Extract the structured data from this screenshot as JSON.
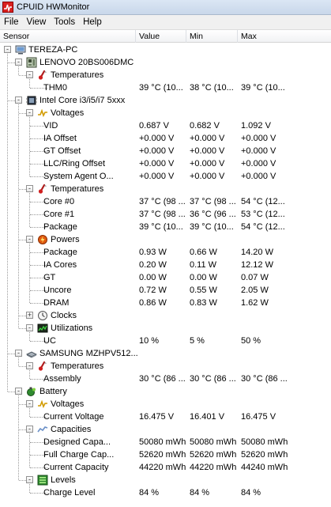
{
  "window": {
    "title": "CPUID HWMonitor"
  },
  "menu": [
    "File",
    "View",
    "Tools",
    "Help"
  ],
  "columns": {
    "sensor": "Sensor",
    "value": "Value",
    "min": "Min",
    "max": "Max"
  },
  "tree": [
    {
      "label": "TEREZA-PC",
      "icon": "computer-icon",
      "expander": "-"
    },
    {
      "label": "LENOVO 20BS006DMC",
      "icon": "motherboard-icon",
      "expander": "-"
    },
    {
      "label": "Temperatures",
      "icon": "thermometer-icon",
      "expander": "-"
    },
    {
      "label": "THM0",
      "value": "39 °C  (10...",
      "min": "38 °C  (10...",
      "max": "39 °C  (10..."
    },
    {
      "label": "Intel Core i3/i5/i7 5xxx",
      "icon": "cpu-chip-icon",
      "expander": "-"
    },
    {
      "label": "Voltages",
      "icon": "voltage-icon",
      "expander": "-"
    },
    {
      "label": "VID",
      "value": "0.687 V",
      "min": "0.682 V",
      "max": "1.092 V"
    },
    {
      "label": "IA Offset",
      "value": "+0.000 V",
      "min": "+0.000 V",
      "max": "+0.000 V"
    },
    {
      "label": "GT Offset",
      "value": "+0.000 V",
      "min": "+0.000 V",
      "max": "+0.000 V"
    },
    {
      "label": "LLC/Ring Offset",
      "value": "+0.000 V",
      "min": "+0.000 V",
      "max": "+0.000 V"
    },
    {
      "label": "System Agent O...",
      "value": "+0.000 V",
      "min": "+0.000 V",
      "max": "+0.000 V"
    },
    {
      "label": "Temperatures",
      "icon": "thermometer-icon",
      "expander": "-"
    },
    {
      "label": "Core #0",
      "value": "37 °C  (98 ...",
      "min": "37 °C  (98 ...",
      "max": "54 °C  (12..."
    },
    {
      "label": "Core #1",
      "value": "37 °C  (98 ...",
      "min": "36 °C  (96 ...",
      "max": "53 °C  (12..."
    },
    {
      "label": "Package",
      "value": "39 °C  (10...",
      "min": "39 °C  (10...",
      "max": "54 °C  (12..."
    },
    {
      "label": "Powers",
      "icon": "power-icon",
      "expander": "-"
    },
    {
      "label": "Package",
      "value": "0.93 W",
      "min": "0.66 W",
      "max": "14.20 W"
    },
    {
      "label": "IA Cores",
      "value": "0.20 W",
      "min": "0.11 W",
      "max": "12.12 W"
    },
    {
      "label": "GT",
      "value": "0.00 W",
      "min": "0.00 W",
      "max": "0.07 W"
    },
    {
      "label": "Uncore",
      "value": "0.72 W",
      "min": "0.55 W",
      "max": "2.05 W"
    },
    {
      "label": "DRAM",
      "value": "0.86 W",
      "min": "0.83 W",
      "max": "1.62 W"
    },
    {
      "label": "Clocks",
      "icon": "clock-icon",
      "expander": "+"
    },
    {
      "label": "Utilizations",
      "icon": "utilization-icon",
      "expander": "-"
    },
    {
      "label": "UC",
      "value": "10 %",
      "min": "5 %",
      "max": "50 %"
    },
    {
      "label": "SAMSUNG MZHPV512...",
      "icon": "drive-icon",
      "expander": "-"
    },
    {
      "label": "Temperatures",
      "icon": "thermometer-icon",
      "expander": "-"
    },
    {
      "label": "Assembly",
      "value": "30 °C  (86 ...",
      "min": "30 °C  (86 ...",
      "max": "30 °C  (86 ..."
    },
    {
      "label": "Battery",
      "icon": "battery-icon",
      "expander": "-"
    },
    {
      "label": "Voltages",
      "icon": "voltage-icon",
      "expander": "-"
    },
    {
      "label": "Current Voltage",
      "value": "16.475 V",
      "min": "16.401 V",
      "max": "16.475 V"
    },
    {
      "label": "Capacities",
      "icon": "capacity-icon",
      "expander": "-"
    },
    {
      "label": "Designed Capa...",
      "value": "50080 mWh",
      "min": "50080 mWh",
      "max": "50080 mWh"
    },
    {
      "label": "Full Charge Cap...",
      "value": "52620 mWh",
      "min": "52620 mWh",
      "max": "52620 mWh"
    },
    {
      "label": "Current Capacity",
      "value": "44220 mWh",
      "min": "44220 mWh",
      "max": "44240 mWh"
    },
    {
      "label": "Levels",
      "icon": "levels-icon",
      "expander": "-"
    },
    {
      "label": "Charge Level",
      "value": "84 %",
      "min": "84 %",
      "max": "84 %"
    }
  ]
}
